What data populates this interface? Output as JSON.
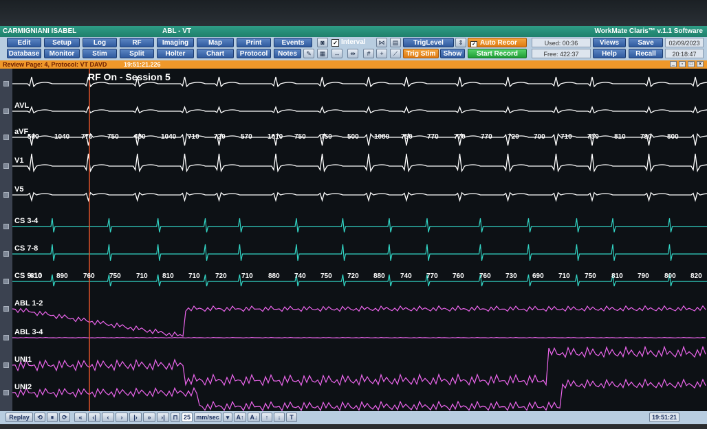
{
  "window": {
    "patient": "CARMIGNIANI ISABEL",
    "study": "ABL - VT",
    "app_name": "WorkMate Claris™ v.1.1 Software"
  },
  "toolbar": {
    "row1": [
      "Edit",
      "Setup",
      "Log",
      "RF",
      "Imaging",
      "Map",
      "Print",
      "Events"
    ],
    "row2": [
      "Database",
      "Monitor",
      "Stim",
      "Split",
      "Holter",
      "Chart",
      "Protocol",
      "Notes"
    ],
    "interval_label": "Interval",
    "triglevel_label": "TrigLevel",
    "trig_stim_label": "Trig Stim",
    "show_label": "Show",
    "auto_record_label": "Auto Recor",
    "start_record_label": "Start Record",
    "used_label": "Used: 00:36",
    "free_label": "Free: 422:37",
    "views_label": "Views",
    "help_label": "Help",
    "save_label": "Save",
    "recall_label": "Recall",
    "date": "02/09/2023",
    "time": "20:18:47"
  },
  "review": {
    "text": "Review Page: 4, Protocol: VT DAVD",
    "timestamp": "19:51:21.226"
  },
  "traces": {
    "session_label": "RF On - Session 5",
    "channels": [
      {
        "label": "",
        "color": "#ffffff"
      },
      {
        "label": "AVL",
        "color": "#ffffff"
      },
      {
        "label": "aVF",
        "color": "#ffffff"
      },
      {
        "label": "V1",
        "color": "#ffffff"
      },
      {
        "label": "V5",
        "color": "#ffffff"
      },
      {
        "label": "CS 3-4",
        "color": "#33d6c6"
      },
      {
        "label": "CS 7-8",
        "color": "#33d6c6"
      },
      {
        "label": "CS 9-10",
        "color": "#33d6c6"
      },
      {
        "label": "ABL 1-2",
        "color": "#ee66ee"
      },
      {
        "label": "ABL 3-4",
        "color": "#ee66ee"
      },
      {
        "label": "UNI1",
        "color": "#ee66ee"
      },
      {
        "label": "UNI2",
        "color": "#ee66ee"
      }
    ],
    "avf_intervals": [
      "560",
      "1040",
      "770",
      "750",
      "480",
      "1040",
      "710",
      "720",
      "570",
      "1010",
      "750",
      "750",
      "500",
      "1080",
      "750",
      "770",
      "770",
      "770",
      "720",
      "700",
      "710",
      "750",
      "810",
      "790",
      "800"
    ],
    "cs_intervals": [
      "810",
      "890",
      "760",
      "750",
      "710",
      "810",
      "710",
      "720",
      "710",
      "880",
      "740",
      "750",
      "720",
      "880",
      "740",
      "770",
      "760",
      "760",
      "730",
      "690",
      "710",
      "750",
      "810",
      "790",
      "800",
      "820"
    ]
  },
  "statusbar": {
    "replay_label": "Replay",
    "speed_value": "25",
    "speed_unit": "mm/sec",
    "clock": "19:51:21"
  },
  "colors": {
    "ecg": "#ffffff",
    "cs": "#33d6c6",
    "abl": "#ee66ee",
    "marker": "#e0522a",
    "title_bar": "#2f9d86",
    "review_bar": "#f0982a"
  }
}
